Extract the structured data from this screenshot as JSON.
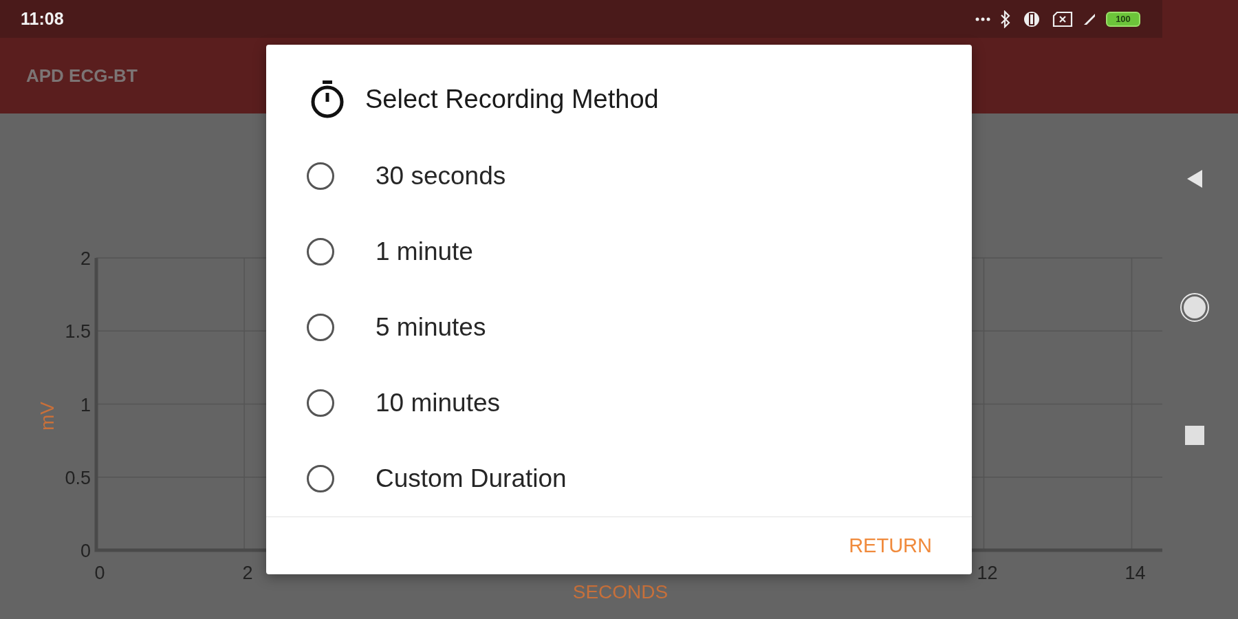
{
  "status_bar": {
    "time": "11:08",
    "battery": "100"
  },
  "app_bar": {
    "title": "APD ECG-BT"
  },
  "chart": {
    "chart_data": {
      "type": "line",
      "xlabel": "SECONDS",
      "ylabel": "mV",
      "xlim": [
        0,
        15
      ],
      "ylim": [
        0,
        2
      ],
      "grid": true,
      "xticks": [
        0,
        2,
        12,
        14
      ],
      "yticks": [
        0,
        0.5,
        1,
        1.5,
        2
      ]
    }
  },
  "dialog": {
    "title": "Select Recording Method",
    "options": [
      {
        "label": "30 seconds",
        "selected": false
      },
      {
        "label": "1 minute",
        "selected": false
      },
      {
        "label": "5 minutes",
        "selected": false
      },
      {
        "label": "10 minutes",
        "selected": false
      },
      {
        "label": "Custom Duration",
        "selected": false
      }
    ],
    "button": "RETURN"
  }
}
